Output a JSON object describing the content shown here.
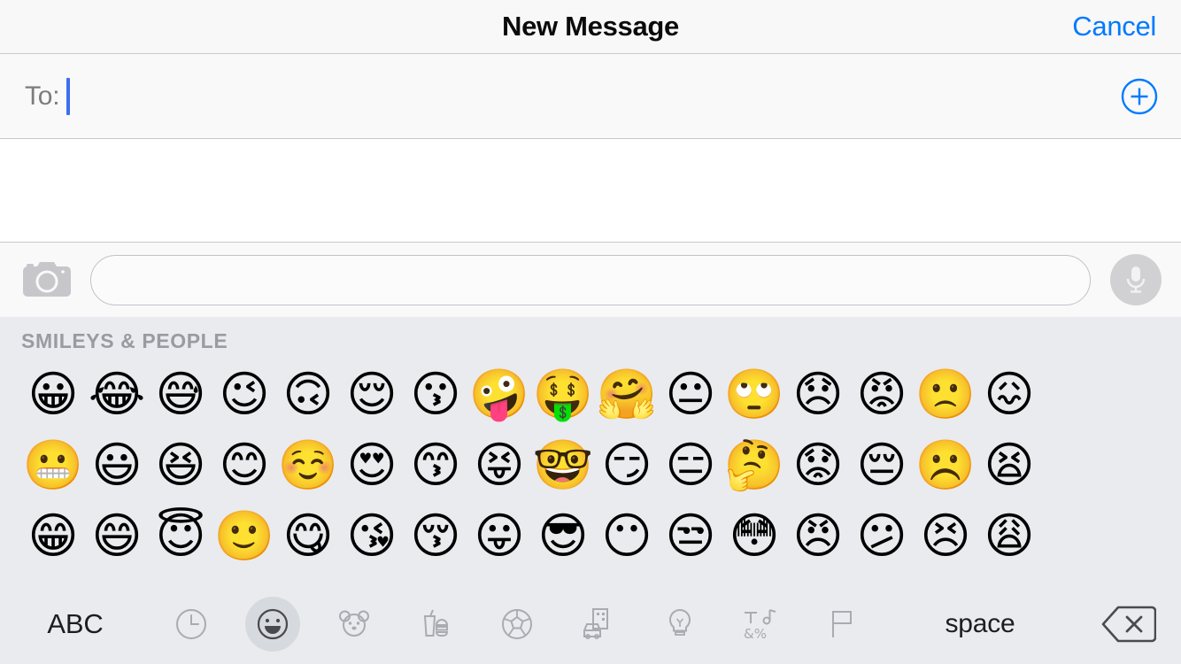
{
  "navbar": {
    "title": "New Message",
    "cancel_label": "Cancel",
    "title_color": "#0b0b0b",
    "accent_color": "#007aff"
  },
  "recipient_field": {
    "label": "To:",
    "value": "",
    "placeholder": "",
    "caret_visible": true,
    "add_contact_icon": "plus-circle-icon"
  },
  "compose_bar": {
    "camera_icon": "camera-icon",
    "input_value": "",
    "input_placeholder": "",
    "mic_icon": "microphone-icon"
  },
  "emoji_keyboard": {
    "section_title": "SMILEYS & PEOPLE",
    "background_color": "#e9ebee",
    "rows": [
      [
        {
          "glyph": "😀",
          "name": "grinning-face"
        },
        {
          "glyph": "😂",
          "name": "face-with-tears-of-joy"
        },
        {
          "glyph": "😅",
          "name": "grinning-face-with-sweat"
        },
        {
          "glyph": "😉",
          "name": "winking-face"
        },
        {
          "glyph": "🙃",
          "name": "upside-down-face"
        },
        {
          "glyph": "😌",
          "name": "relieved-face"
        },
        {
          "glyph": "😗",
          "name": "kissing-face"
        },
        {
          "glyph": "🤪",
          "name": "zany-face"
        },
        {
          "glyph": "🤑",
          "name": "money-mouth-face"
        },
        {
          "glyph": "🤗",
          "name": "hugging-face"
        },
        {
          "glyph": "😐",
          "name": "neutral-face"
        },
        {
          "glyph": "🙄",
          "name": "face-with-rolling-eyes"
        },
        {
          "glyph": "😞",
          "name": "disappointed-face"
        },
        {
          "glyph": "😡",
          "name": "pouting-face"
        },
        {
          "glyph": "🙁",
          "name": "slightly-frowning-face"
        },
        {
          "glyph": "😖",
          "name": "confounded-face"
        }
      ],
      [
        {
          "glyph": "😬",
          "name": "grimacing-face"
        },
        {
          "glyph": "😃",
          "name": "grinning-face-with-big-eyes"
        },
        {
          "glyph": "😆",
          "name": "grinning-squinting-face"
        },
        {
          "glyph": "😊",
          "name": "smiling-face-with-smiling-eyes"
        },
        {
          "glyph": "☺️",
          "name": "smiling-face"
        },
        {
          "glyph": "😍",
          "name": "smiling-face-with-heart-eyes"
        },
        {
          "glyph": "😙",
          "name": "kissing-face-with-smiling-eyes"
        },
        {
          "glyph": "😝",
          "name": "squinting-face-with-tongue"
        },
        {
          "glyph": "🤓",
          "name": "nerd-face"
        },
        {
          "glyph": "😏",
          "name": "smirking-face"
        },
        {
          "glyph": "😑",
          "name": "expressionless-face"
        },
        {
          "glyph": "🤔",
          "name": "thinking-face"
        },
        {
          "glyph": "😟",
          "name": "worried-face"
        },
        {
          "glyph": "😔",
          "name": "pensive-face"
        },
        {
          "glyph": "☹️",
          "name": "frowning-face"
        },
        {
          "glyph": "😫",
          "name": "tired-face"
        }
      ],
      [
        {
          "glyph": "😁",
          "name": "beaming-face-with-smiling-eyes"
        },
        {
          "glyph": "😄",
          "name": "grinning-face-with-smiling-eyes"
        },
        {
          "glyph": "😇",
          "name": "smiling-face-with-halo"
        },
        {
          "glyph": "🙂",
          "name": "slightly-smiling-face"
        },
        {
          "glyph": "😋",
          "name": "face-savoring-food"
        },
        {
          "glyph": "😘",
          "name": "face-blowing-a-kiss"
        },
        {
          "glyph": "😚",
          "name": "kissing-face-with-closed-eyes"
        },
        {
          "glyph": "😛",
          "name": "face-with-tongue"
        },
        {
          "glyph": "😎",
          "name": "smiling-face-with-sunglasses"
        },
        {
          "glyph": "😶",
          "name": "face-without-mouth"
        },
        {
          "glyph": "😒",
          "name": "unamused-face"
        },
        {
          "glyph": "😳",
          "name": "flushed-face"
        },
        {
          "glyph": "😠",
          "name": "angry-face"
        },
        {
          "glyph": "😕",
          "name": "confused-face"
        },
        {
          "glyph": "😣",
          "name": "persevering-face"
        },
        {
          "glyph": "😩",
          "name": "weary-face"
        }
      ]
    ]
  },
  "keyboard_bar": {
    "abc_label": "ABC",
    "space_label": "space",
    "delete_icon": "backspace-icon",
    "categories": [
      {
        "name": "recents-clock-icon",
        "active": false
      },
      {
        "name": "smileys-people-icon",
        "active": true
      },
      {
        "name": "animals-nature-icon",
        "active": false
      },
      {
        "name": "food-drink-icon",
        "active": false
      },
      {
        "name": "activity-icon",
        "active": false
      },
      {
        "name": "travel-places-icon",
        "active": false
      },
      {
        "name": "objects-icon",
        "active": false
      },
      {
        "name": "symbols-icon",
        "active": false
      },
      {
        "name": "flags-icon",
        "active": false
      }
    ]
  }
}
